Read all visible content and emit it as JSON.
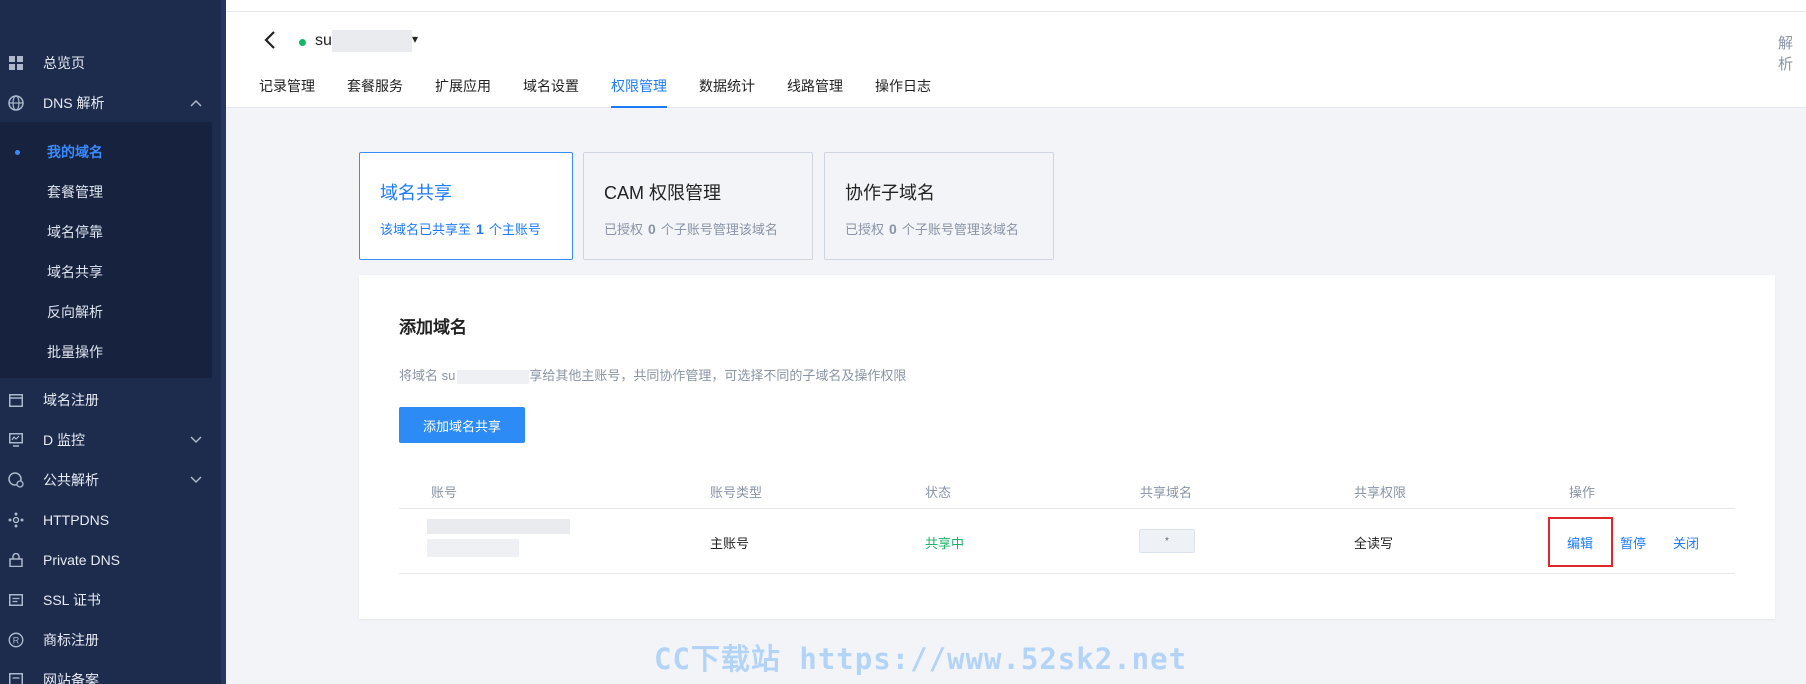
{
  "sidebar": {
    "items": [
      {
        "label": "总览页",
        "icon": "grid-icon"
      },
      {
        "label": "DNS 解析",
        "icon": "globe-icon"
      },
      {
        "label": "域名注册",
        "icon": "calendar-icon"
      },
      {
        "label": "D 监控",
        "icon": "monitor-icon"
      },
      {
        "label": "公共解析",
        "icon": "network-globe-icon"
      },
      {
        "label": "HTTPDNS",
        "icon": "nodes-icon"
      },
      {
        "label": "Private DNS",
        "icon": "lock-icon"
      },
      {
        "label": "SSL 证书",
        "icon": "certificate-icon"
      },
      {
        "label": "商标注册",
        "icon": "registered-icon"
      },
      {
        "label": "网站备案",
        "icon": "filing-icon"
      }
    ],
    "dns_sub": [
      {
        "label": "我的域名",
        "active": true
      },
      {
        "label": "套餐管理"
      },
      {
        "label": "域名停靠"
      },
      {
        "label": "域名共享"
      },
      {
        "label": "反向解析"
      },
      {
        "label": "批量操作"
      }
    ]
  },
  "header": {
    "domain_prefix": "su",
    "caret": "▾",
    "right_text": "解析",
    "tabs": [
      "记录管理",
      "套餐服务",
      "扩展应用",
      "域名设置",
      "权限管理",
      "数据统计",
      "线路管理",
      "操作日志"
    ],
    "active_tab": "权限管理"
  },
  "cards": [
    {
      "title": "域名共享",
      "sub_prefix": "该域名已共享至",
      "count": "1",
      "sub_suffix": "个主账号"
    },
    {
      "title": "CAM 权限管理",
      "sub_prefix": "已授权",
      "count": "0",
      "sub_suffix": "个子账号管理该域名"
    },
    {
      "title": "协作子域名",
      "sub_prefix": "已授权",
      "count": "0",
      "sub_suffix": "个子账号管理该域名"
    }
  ],
  "panel": {
    "title": "添加域名",
    "desc_prefix": "将域名 su",
    "desc_suffix": "享给其他主账号，共同协作管理，可选择不同的子域名及操作权限",
    "add_button": "添加域名共享",
    "columns": [
      "账号",
      "账号类型",
      "状态",
      "共享域名",
      "共享权限",
      "操作"
    ],
    "row": {
      "type": "主账号",
      "status": "共享中",
      "domain_select": "*",
      "permission": "全读写",
      "actions": [
        "编辑",
        "暂停",
        "关闭"
      ]
    }
  },
  "watermark": "CC下载站 https://www.52sk2.net",
  "colors": {
    "sidebar_bg": "#1d2b4d",
    "accent": "#1d7bff",
    "success": "#18b566",
    "highlight_box": "#e0262a"
  }
}
